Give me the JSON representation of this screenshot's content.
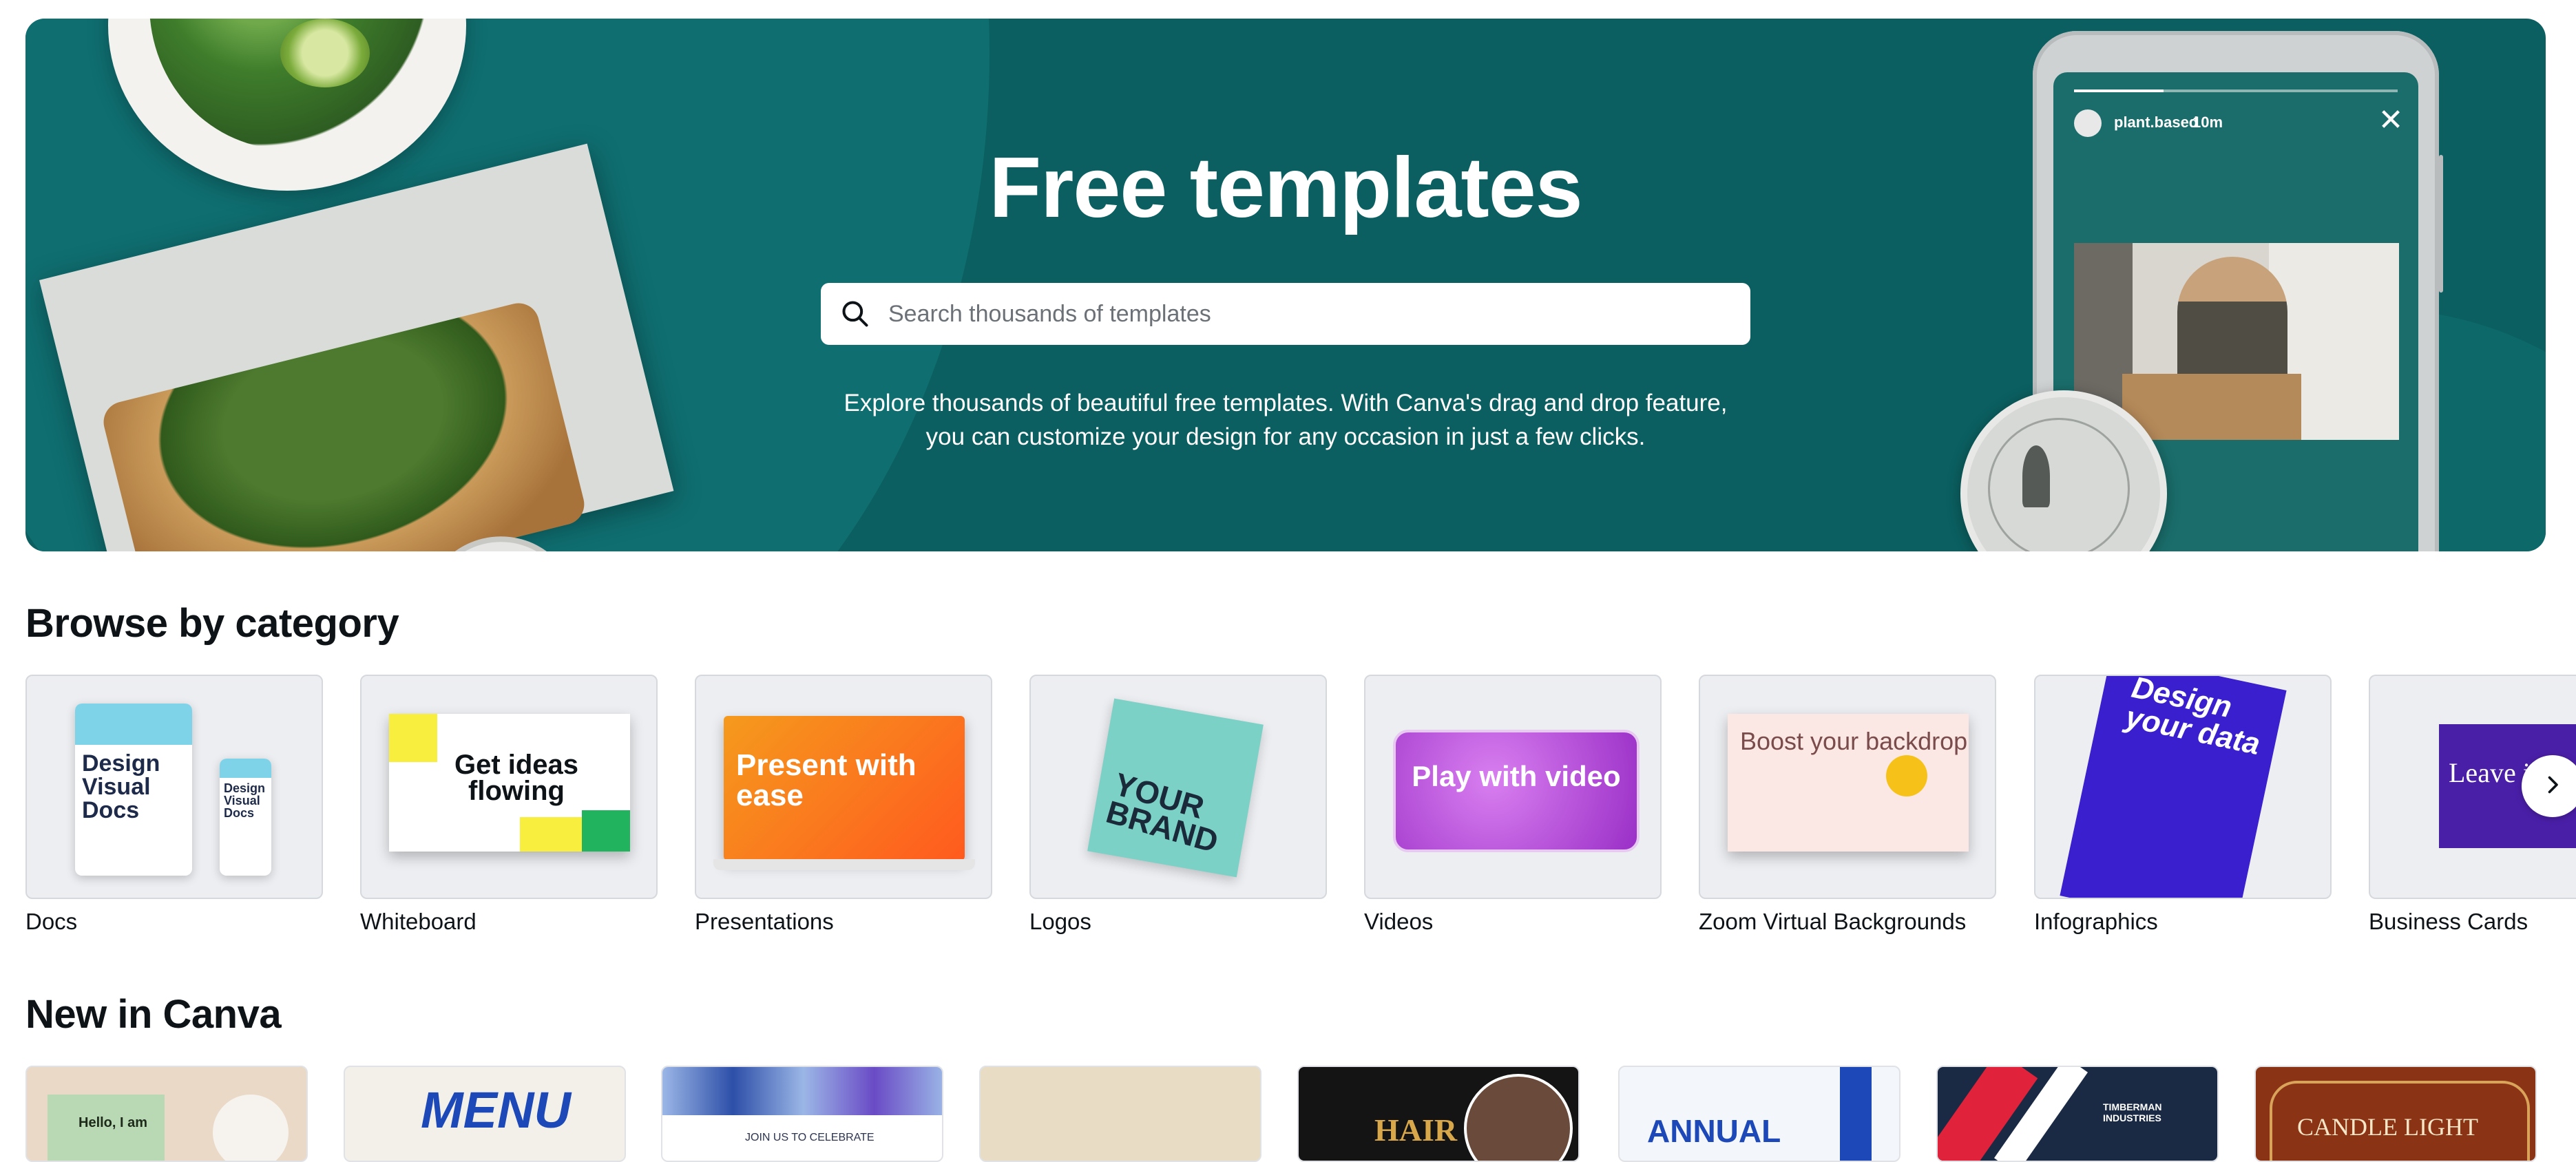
{
  "hero": {
    "title": "Free templates",
    "search_placeholder": "Search thousands of templates",
    "description": "Explore thousands of beautiful free templates. With Canva's drag and drop feature, you can customize your design for any occasion in just a few clicks.",
    "story_username": "plant.based",
    "story_time": "10m"
  },
  "browse": {
    "title": "Browse by category",
    "categories": [
      {
        "label": "Docs"
      },
      {
        "label": "Whiteboard"
      },
      {
        "label": "Presentations"
      },
      {
        "label": "Logos"
      },
      {
        "label": "Videos"
      },
      {
        "label": "Zoom Virtual Backgrounds"
      },
      {
        "label": "Infographics"
      },
      {
        "label": "Business Cards"
      }
    ],
    "thumb_text": {
      "docs_big": "Design Visual Docs",
      "docs_small": "Design Visual Docs",
      "whiteboard": "Get ideas flowing",
      "presentations": "Present with ease",
      "logos": "YOUR BRAND",
      "videos": "Play with video",
      "zoom": "Boost your backdrop",
      "infographics": "Design your data",
      "business_cards": "Leave impre"
    }
  },
  "new_in_canva": {
    "title": "New in Canva",
    "cards": [
      {
        "text": "Hello, I am",
        "color": "#e9d9c6"
      },
      {
        "text": "MENU",
        "color": "#f3f0ea"
      },
      {
        "text": "JOIN US TO CELEBRATE",
        "color": "#dfe8f6"
      },
      {
        "text": "",
        "color": "#e8dcc4"
      },
      {
        "text": "HAIR",
        "color": "#141414"
      },
      {
        "text": "ANNUAL",
        "color": "#f3f6fb"
      },
      {
        "text": "TIMBERMAN INDUSTRIES",
        "color": "#1b2a44"
      },
      {
        "text": "CANDLE LIGHT",
        "color": "#8a3415"
      }
    ]
  },
  "colors": {
    "hero_bg": "#0b5f60",
    "accent_text": "#0e1318"
  },
  "icons": [
    "search-icon",
    "close-icon",
    "chevron-right-icon"
  ]
}
